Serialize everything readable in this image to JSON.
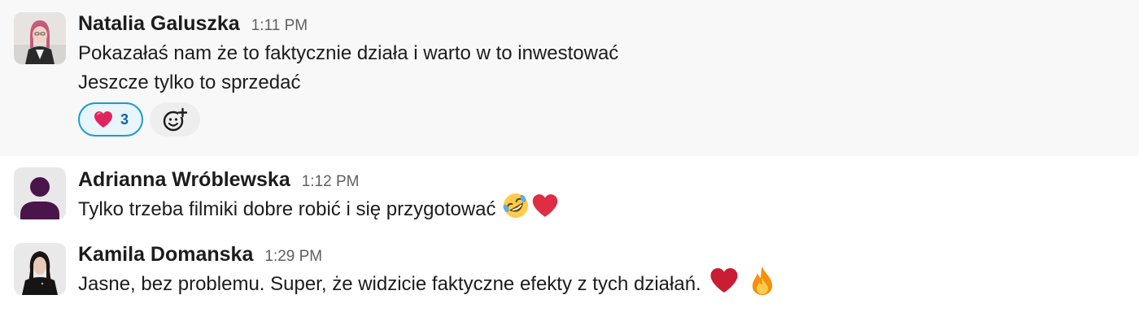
{
  "messages": [
    {
      "author": "Natalia Galuszka",
      "time": "1:11 PM",
      "avatar": "photo-avatar",
      "lines": [
        "Pokazałaś nam że to faktycznie działa i warto w to inwestować",
        "Jeszcze tylko to sprzedać"
      ],
      "reactions": [
        {
          "emoji": "red-heart",
          "count": "3",
          "selected": true
        }
      ]
    },
    {
      "author": "Adrianna Wróblewska",
      "time": "1:12 PM",
      "avatar": "default-user-avatar",
      "lines": [
        "Tylko trzeba filmiki dobre robić i się przygotować"
      ],
      "emojis": [
        "rolling-on-floor-laughing",
        "red-heart"
      ]
    },
    {
      "author": "Kamila Domanska",
      "time": "1:29 PM",
      "avatar": "photo-avatar",
      "lines": [
        "Jasne, bez problemu. Super, że widzicie faktyczne efekty z tych działań."
      ],
      "emojis": [
        "red-heart",
        "fire"
      ]
    }
  ],
  "colors": {
    "highlight_bg": "#f8f8f8",
    "reaction_border": "#1d9bd1",
    "reaction_bg": "#e8f5fa",
    "reaction_count": "#1264a3",
    "default_avatar": "#4a154b",
    "time_text": "#616061"
  }
}
